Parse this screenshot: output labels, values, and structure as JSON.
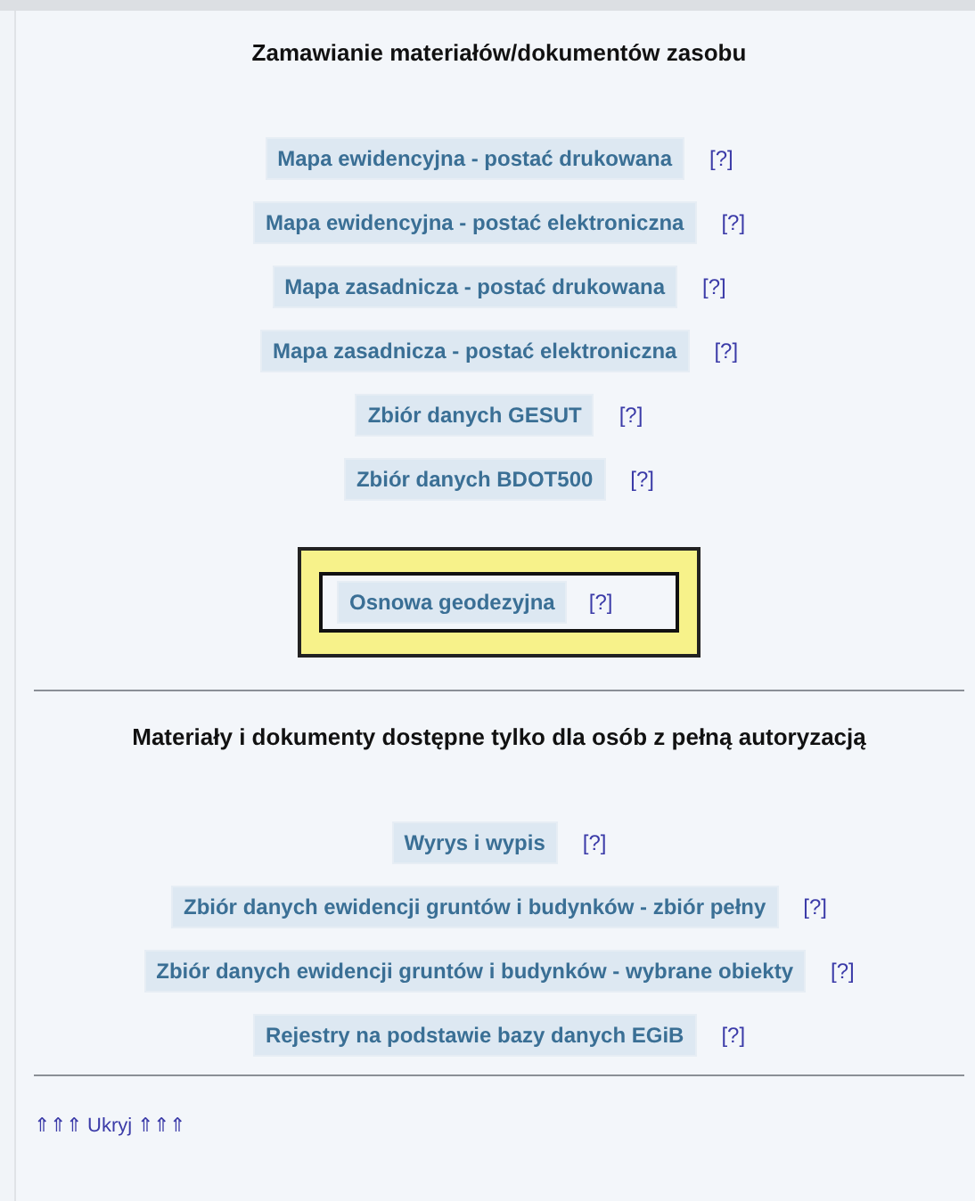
{
  "sections": [
    {
      "heading": "Zamawianie materiałów/dokumentów zasobu",
      "items": [
        {
          "label": "Mapa ewidencyjna - postać drukowana",
          "help": "[?]",
          "highlighted": false
        },
        {
          "label": "Mapa ewidencyjna - postać elektroniczna",
          "help": "[?]",
          "highlighted": false
        },
        {
          "label": "Mapa zasadnicza - postać drukowana",
          "help": "[?]",
          "highlighted": false
        },
        {
          "label": "Mapa zasadnicza - postać elektroniczna",
          "help": "[?]",
          "highlighted": false
        },
        {
          "label": "Zbiór danych GESUT",
          "help": "[?]",
          "highlighted": false
        },
        {
          "label": "Zbiór danych BDOT500",
          "help": "[?]",
          "highlighted": false
        },
        {
          "label": "Osnowa geodezyjna",
          "help": "[?]",
          "highlighted": true
        }
      ]
    },
    {
      "heading": "Materiały i dokumenty dostępne tylko dla osób z pełną autoryzacją",
      "items": [
        {
          "label": "Wyrys i wypis",
          "help": "[?]",
          "highlighted": false
        },
        {
          "label": "Zbiór danych ewidencji gruntów i budynków - zbiór pełny",
          "help": "[?]",
          "highlighted": false
        },
        {
          "label": "Zbiór danych ewidencji gruntów i budynków - wybrane obiekty",
          "help": "[?]",
          "highlighted": false
        },
        {
          "label": "Rejestry na podstawie bazy danych EGiB",
          "help": "[?]",
          "highlighted": false
        }
      ]
    }
  ],
  "footer_link": "⇑⇑⇑ Ukryj ⇑⇑⇑"
}
